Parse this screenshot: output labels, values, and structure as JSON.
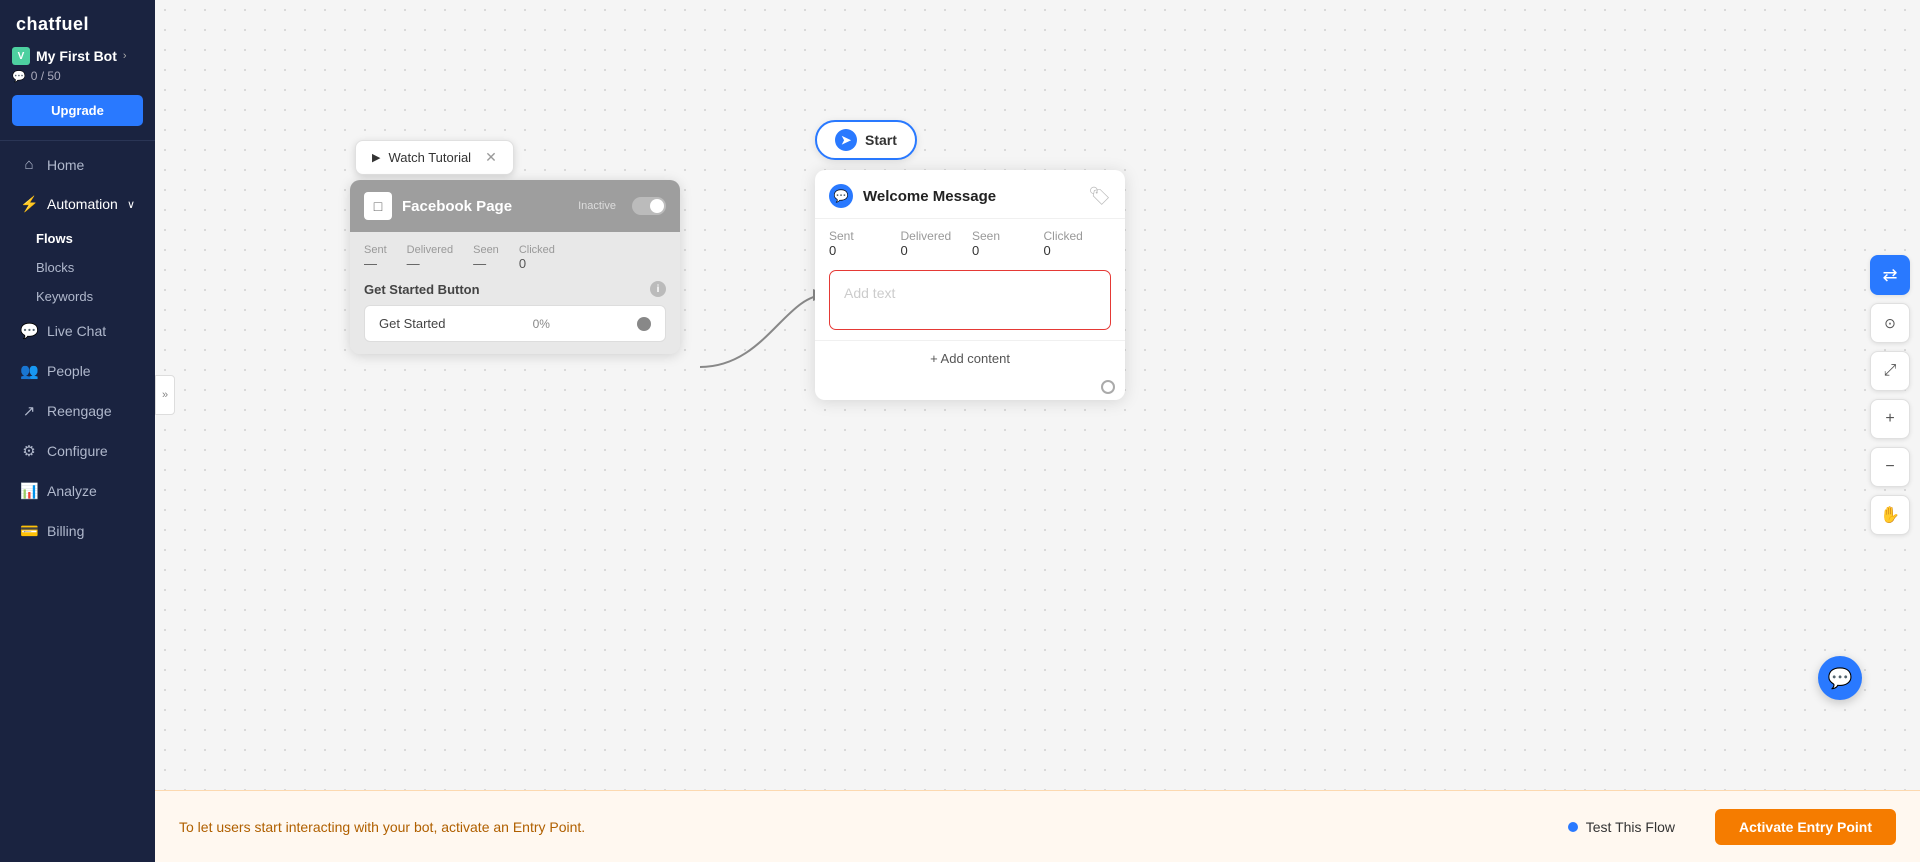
{
  "sidebar": {
    "logo": "chatfuel",
    "bot": {
      "name": "My First Bot",
      "icon": "V",
      "quota": "0 / 50"
    },
    "upgrade_label": "Upgrade",
    "nav_items": [
      {
        "id": "home",
        "icon": "⌂",
        "label": "Home"
      },
      {
        "id": "automation",
        "icon": "⚡",
        "label": "Automation"
      },
      {
        "id": "flows",
        "label": "Flows",
        "sub": true
      },
      {
        "id": "blocks",
        "label": "Blocks",
        "sub": true
      },
      {
        "id": "keywords",
        "label": "Keywords",
        "sub": true
      },
      {
        "id": "livechat",
        "icon": "💬",
        "label": "Live Chat"
      },
      {
        "id": "people",
        "icon": "👥",
        "label": "People"
      },
      {
        "id": "reengage",
        "icon": "↗",
        "label": "Reengage"
      },
      {
        "id": "configure",
        "icon": "⚙",
        "label": "Configure"
      },
      {
        "id": "analyze",
        "icon": "📊",
        "label": "Analyze"
      },
      {
        "id": "billing",
        "icon": "💳",
        "label": "Billing"
      }
    ]
  },
  "canvas": {
    "watch_tutorial": "Watch Tutorial",
    "fb_node": {
      "title": "Facebook Page",
      "status": "Inactive",
      "stats": {
        "sent_label": "Sent",
        "sent_val": "—",
        "delivered_label": "Delivered",
        "delivered_val": "—",
        "seen_label": "Seen",
        "seen_val": "—",
        "clicked_label": "Clicked",
        "clicked_val": "0"
      },
      "section_title": "Get Started Button",
      "button_label": "Get Started",
      "button_pct": "0%"
    },
    "start_label": "Start",
    "welcome_node": {
      "title": "Welcome Message",
      "stats": {
        "sent_label": "Sent",
        "sent_val": "0",
        "delivered_label": "Delivered",
        "delivered_val": "0",
        "seen_label": "Seen",
        "seen_val": "0",
        "clicked_label": "Clicked",
        "clicked_val": "0"
      },
      "placeholder": "Add text",
      "add_content": "+ Add content"
    }
  },
  "toolbar": {
    "flow_icon": "⇄",
    "node_icon": "⊙",
    "expand_icon": "⤢",
    "zoom_in": "+",
    "zoom_out": "−",
    "hand_icon": "✋"
  },
  "bottom_bar": {
    "notice": "To let users start interacting with your bot, activate an Entry Point.",
    "test_flow": "Test This Flow",
    "activate": "Activate Entry Point"
  }
}
